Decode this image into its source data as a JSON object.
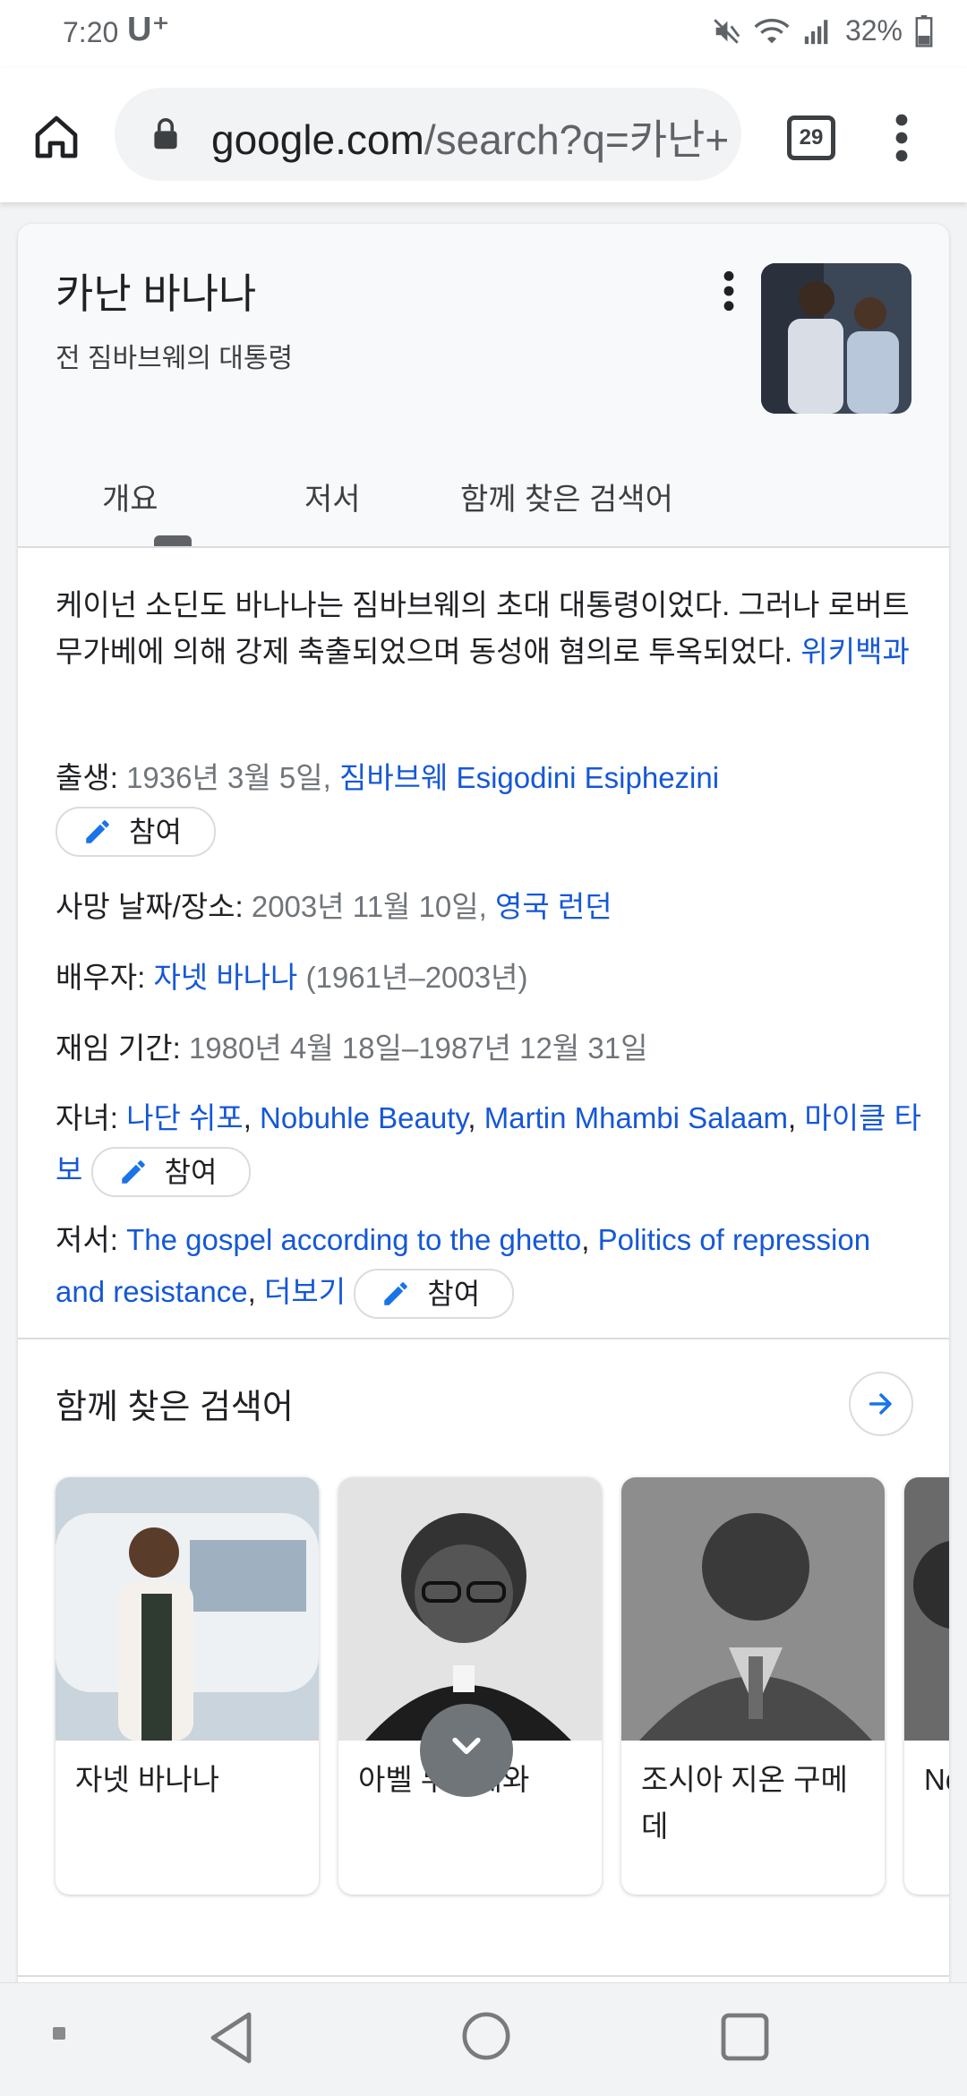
{
  "status_bar": {
    "time": "7:20",
    "carrier": "U⁺",
    "battery": "32%"
  },
  "browser": {
    "url_host": "google.com",
    "url_rest": "/search?q=카난+",
    "tab_count": "29"
  },
  "knowledge_panel": {
    "title": "카난 바나나",
    "subtitle": "전 짐바브웨의 대통령",
    "tabs": [
      "개요",
      "저서",
      "함께 찾은 검색어"
    ],
    "description": "케이넌 소딘도 바나나는 짐바브웨의 초대 대통령이었다. 그러나 로버트 무가베에 의해 강제 축출되었으며 동성애 혐의로 투옥되었다.",
    "description_source": "위키백과",
    "edit_label": "참여",
    "facts": {
      "born": {
        "label": "출생",
        "value": "1936년 3월 5일, ",
        "place": "짐바브웨 Esigodini Esiphezini"
      },
      "died": {
        "label": "사망 날짜/장소",
        "value": "2003년 11월 10일, ",
        "place": "영국 런던"
      },
      "spouse": {
        "label": "배우자",
        "name": "자넷 바나나",
        "years": "(1961년–2003년)"
      },
      "term": {
        "label": "재임 기간",
        "value": "1980년 4월 18일–1987년 12월 31일"
      },
      "children": {
        "label": "자녀",
        "items": [
          "나단 쉬포",
          "Nobuhle Beauty",
          "Martin Mhambi Salaam",
          "마이클 타보"
        ]
      },
      "books": {
        "label": "저서",
        "items": [
          "The gospel according to the ghetto",
          "Politics of repression and resistance"
        ],
        "more": "더보기"
      }
    }
  },
  "people_also_search": {
    "title": "함께 찾은 검색어",
    "items": [
      {
        "name": "자넷 바나나"
      },
      {
        "name": "아벨 무조레와"
      },
      {
        "name": "조시아 지온 구메데"
      },
      {
        "name": "Nda Sith"
      }
    ]
  },
  "colors": {
    "link": "#1558d6",
    "accent": "#1a73e8"
  }
}
